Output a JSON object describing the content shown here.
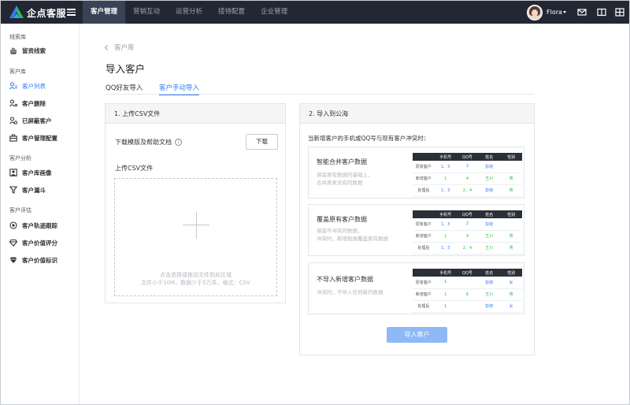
{
  "colors": {
    "topbar": "#222733",
    "accent": "#2f7df6",
    "green": "#2dbd4d",
    "import_button": "#8fb8f8"
  },
  "topbar": {
    "brand": "企点客服",
    "nav": [
      "客户管理",
      "营销互动",
      "运营分析",
      "接待配置",
      "企业管理"
    ],
    "active_nav": "客户管理",
    "user": "Flora",
    "icons": [
      "mail-icon",
      "book-icon",
      "grid-icon"
    ]
  },
  "sidebar": {
    "groups": [
      {
        "title": "线索库",
        "items": [
          {
            "label": "留资线索",
            "icon": "hand-icon"
          }
        ]
      },
      {
        "title": "客户库",
        "items": [
          {
            "label": "客户列表",
            "icon": "user-list-icon",
            "active": true
          },
          {
            "label": "客户删除",
            "icon": "user-remove-icon"
          },
          {
            "label": "已屏蔽客户",
            "icon": "user-block-icon"
          },
          {
            "label": "客户管理配置",
            "icon": "briefcase-icon"
          }
        ]
      },
      {
        "title": "客户分析",
        "items": [
          {
            "label": "客户库画像",
            "icon": "portrait-icon"
          },
          {
            "label": "客户漏斗",
            "icon": "funnel-icon"
          }
        ]
      },
      {
        "title": "客户评估",
        "items": [
          {
            "label": "客户轨迹跟踪",
            "icon": "target-icon"
          },
          {
            "label": "客户价值评分",
            "icon": "diamond-icon"
          },
          {
            "label": "客户价值标识",
            "icon": "diamond-tag-icon"
          }
        ]
      }
    ]
  },
  "main": {
    "breadcrumb": "客户库",
    "title": "导入客户",
    "tabs": [
      "QQ好友导入",
      "客户手动导入"
    ],
    "active_tab": "客户手动导入",
    "upload_panel": {
      "header": "1. 上传CSV文件",
      "download_label": "下载模版及帮助文档",
      "download_button": "下载",
      "upload_label": "上传CSV文件",
      "drop_text_1": "点击选择或拖动文件到此区域",
      "drop_text_2": "文件小于10M，数据少于5万条，格式：CSV"
    },
    "sea_panel": {
      "header": "2. 导入到公海",
      "desc": "当新增客户的手机或QQ号与现有客户冲突时：",
      "table_headers": [
        "",
        "手机号",
        "QQ号",
        "姓名",
        "性别"
      ],
      "options": [
        {
          "title": "智能合并客户数据",
          "sub": [
            "保留原有数据的基础上，",
            "合并原来没有的数据"
          ],
          "rows": [
            [
              "原有客户",
              "1、3",
              "2",
              "彭晓",
              ""
            ],
            [
              "新增客户",
              "1",
              "4",
              "王川",
              "男"
            ],
            [
              "处理后",
              "1、3",
              "2、4",
              "彭晓",
              "男"
            ]
          ]
        },
        {
          "title": "覆盖原有客户数据",
          "sub": [
            "保留不冲突的数据，",
            "冲突时，新增数据覆盖原有数据"
          ],
          "rows": [
            [
              "原有客户",
              "1、3",
              "2",
              "彭晓",
              ""
            ],
            [
              "新增客户",
              "1",
              "4",
              "王川",
              "男"
            ],
            [
              "处理后",
              "1、3",
              "2、4",
              "王川",
              "男"
            ]
          ]
        },
        {
          "title": "不导入新增客户数据",
          "sub": [
            "冲突时，不导入任何新的数据"
          ],
          "rows": [
            [
              "原有客户",
              "1",
              "",
              "彭晓",
              "女"
            ],
            [
              "新增客户",
              "1",
              "6",
              "王川",
              "男"
            ],
            [
              "处理后",
              "1",
              "",
              "彭晓",
              "女"
            ]
          ]
        }
      ],
      "import_button": "导入客户"
    }
  }
}
